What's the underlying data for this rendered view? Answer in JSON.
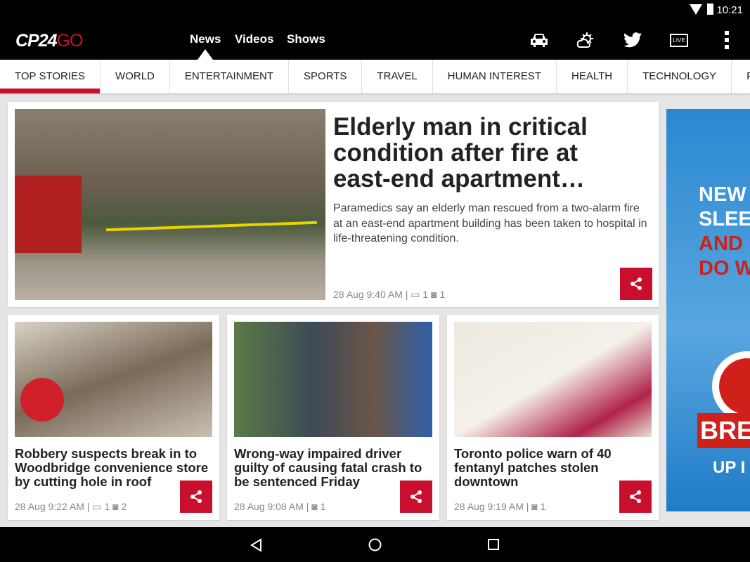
{
  "status": {
    "time": "10:21"
  },
  "app": {
    "logo_main": "CP24",
    "logo_go": "GO",
    "nav": [
      "News",
      "Videos",
      "Shows"
    ],
    "live_label": "LIVE"
  },
  "tabs": [
    "TOP STORIES",
    "WORLD",
    "ENTERTAINMENT",
    "SPORTS",
    "TRAVEL",
    "HUMAN INTEREST",
    "HEALTH",
    "TECHNOLOGY",
    "PHOTOS"
  ],
  "hero": {
    "title": "Elderly man in critical condition after fire at east-end apartment…",
    "description": "Paramedics say an elderly man rescued from a two-alarm fire at an east-end apartment building has been taken to hospital in life-threatening condition.",
    "time": "28 Aug 9:40 AM |",
    "videos": "1",
    "photos": "1"
  },
  "stories": [
    {
      "title": "Robbery suspects break in to Woodbridge convenience store by cutting hole in roof",
      "time": "28 Aug 9:22 AM |",
      "videos": "1",
      "photos": "2"
    },
    {
      "title": "Wrong-way impaired driver guilty of causing fatal crash to be sentenced Friday",
      "time": "28 Aug 9:08 AM |",
      "photos": "1"
    },
    {
      "title": "Toronto police warn of 40 fentanyl patches stolen downtown",
      "time": "28 Aug 9:19 AM |",
      "photos": "1"
    }
  ],
  "ad": {
    "lines": [
      "NEW",
      "SLEE",
      "AND",
      "DO W"
    ],
    "brand": "BRE",
    "footer": "UP I"
  },
  "colors": {
    "accent": "#c8102e",
    "bar": "#000000"
  }
}
